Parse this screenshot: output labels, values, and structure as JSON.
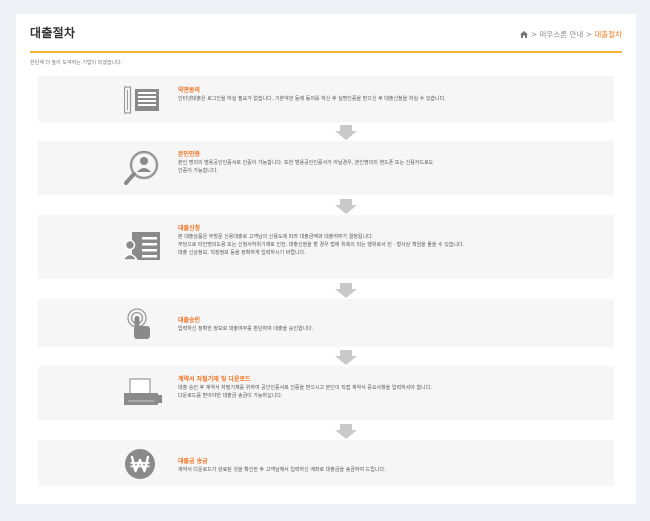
{
  "header": {
    "title": "대출절차",
    "breadcrumb": {
      "home_icon": "home-icon",
      "sep1": ">",
      "item1": "머우스론 안내",
      "sep2": ">",
      "current": "대출절차"
    }
  },
  "subnote": "한단계 더 높이 도약하는 기업이 되겠습니다.",
  "steps": [
    {
      "icon": "document-list-icon",
      "title": "약관동의",
      "lines": [
        "인터넷대출은 로그인을 하실 필요가 없습니다.  기본약관 등에 동의를 하신 후 실명인증을 받으신 후 대출신청을 하실 수 있습니다."
      ]
    },
    {
      "icon": "identity-check-icon",
      "title": "본인인증",
      "lines": [
        "본인 명의의 범용공인인증서로 인증이 가능합니다. 또한 범용공인인증서가 아닐경우, 본인명의의 핸드폰 또는 신용카드로도",
        "인증이 가능합니다."
      ]
    },
    {
      "icon": "application-form-icon",
      "title": "대출신청",
      "lines": [
        "본 대출상품은 무방문 신용대출로 고객님의 신용도에 따라 대출금액과 대출여부가 결정됩니다.",
        "부당으로 타인명의도용 또는 신청서허위기재로 인한, 대출신청을 할 경우 법에 위촉이 되는 행위로서 민ㆍ형사상 책임을 물을 수 있습니다.",
        "대출 신상정보, 직장정보 등을 정확하게 입력하시기 바랍니다."
      ]
    },
    {
      "icon": "touch-approve-icon",
      "title": "대출승인",
      "lines": [
        "입력하신 정확한 정보로 대출여부를 판단하여 대출을 승인합니다."
      ]
    },
    {
      "icon": "printer-icon",
      "title": "계약서 자필기재 및 다운로드",
      "lines": [
        "대출 승인 후 계약서 자필기재를 위하여 공인인증서로 인증을 받으시고 본인이 직접 계약서 중요사항을 입력하셔야 합니다.",
        "다운로드를 받아야만 대출금 송금이 가능하십니다."
      ]
    },
    {
      "icon": "won-coin-icon",
      "title": "대출금 송금",
      "lines": [
        "계약서 다운로드가 완료된 것을 확인한 후 고객님께서 입력하신 계좌로 대출금을 송금하여 드립니다."
      ]
    }
  ]
}
